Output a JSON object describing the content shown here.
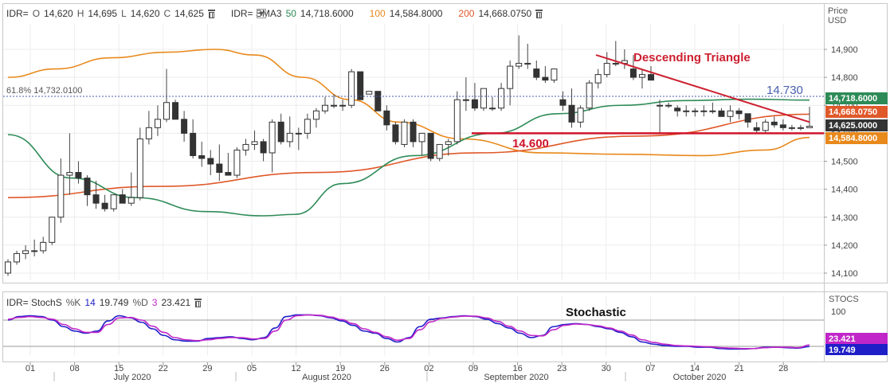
{
  "legend_main": {
    "symbol": "IDR=",
    "o_label": "O",
    "o_value": "14,620",
    "h_label": "H",
    "h_value": "14,695",
    "l_label": "L",
    "l_value": "14,620",
    "c_label": "C",
    "c_value": "14,625",
    "sma_label": "IDR= SMA3",
    "sma50_period": "50",
    "sma50_value": "14,718.6000",
    "sma100_period": "100",
    "sma100_value": "14,584.8000",
    "sma200_period": "200",
    "sma200_value": "14,668.0750"
  },
  "legend_stoch": {
    "label": "IDR= StochS",
    "k_label": "%K",
    "k_period": "14",
    "k_value": "19.749",
    "d_label": "%D",
    "d_period": "3",
    "d_value": "23.421"
  },
  "axis": {
    "price_title_1": "Price",
    "price_title_2": "USD",
    "stoch_title": "STOCS"
  },
  "colors": {
    "sma50": "#2e8b57",
    "sma100": "#e8891c",
    "sma200": "#e0592a",
    "triangle": "#cc2030",
    "support": "#d0142a",
    "stoch_k": "#1f1fc8",
    "stoch_d": "#c026c8",
    "fib": "#4a5fb0"
  },
  "chart_data": [
    {
      "type": "candlestick",
      "title": "",
      "ylabel": "Price USD",
      "ylim": [
        14070,
        14960
      ],
      "y_ticks": [
        "14,900",
        "14,800",
        "14,700",
        "14,600",
        "14,500",
        "14,400",
        "14,300",
        "14,200",
        "14,100"
      ],
      "x_ticks": [
        "01",
        "08",
        "15",
        "22",
        "29",
        "05",
        "12",
        "19",
        "26",
        "02",
        "09",
        "16",
        "23",
        "30",
        "07",
        "14",
        "21",
        "28"
      ],
      "months": [
        "July 2020",
        "August 2020",
        "September 2020",
        "October 2020"
      ],
      "candles_ohlc": [
        [
          14100,
          14150,
          14090,
          14140
        ],
        [
          14140,
          14180,
          14130,
          14170
        ],
        [
          14170,
          14200,
          14150,
          14180
        ],
        [
          14180,
          14220,
          14160,
          14180
        ],
        [
          14180,
          14230,
          14170,
          14210
        ],
        [
          14210,
          14300,
          14200,
          14300
        ],
        [
          14300,
          14510,
          14280,
          14450
        ],
        [
          14450,
          14600,
          14380,
          14460
        ],
        [
          14460,
          14500,
          14420,
          14440
        ],
        [
          14440,
          14450,
          14340,
          14380
        ],
        [
          14380,
          14430,
          14330,
          14350
        ],
        [
          14350,
          14380,
          14320,
          14330
        ],
        [
          14330,
          14380,
          14320,
          14380
        ],
        [
          14380,
          14400,
          14350,
          14350
        ],
        [
          14350,
          14460,
          14340,
          14370
        ],
        [
          14370,
          14620,
          14360,
          14580
        ],
        [
          14580,
          14680,
          14560,
          14620
        ],
        [
          14620,
          14700,
          14590,
          14650
        ],
        [
          14650,
          14830,
          14640,
          14710
        ],
        [
          14710,
          14720,
          14650,
          14650
        ],
        [
          14650,
          14680,
          14570,
          14600
        ],
        [
          14600,
          14650,
          14510,
          14520
        ],
        [
          14520,
          14570,
          14480,
          14510
        ],
        [
          14510,
          14540,
          14450,
          14490
        ],
        [
          14490,
          14560,
          14430,
          14460
        ],
        [
          14460,
          14530,
          14450,
          14450
        ],
        [
          14450,
          14550,
          14440,
          14540
        ],
        [
          14540,
          14580,
          14520,
          14560
        ],
        [
          14560,
          14610,
          14540,
          14570
        ],
        [
          14570,
          14580,
          14500,
          14530
        ],
        [
          14530,
          14650,
          14460,
          14640
        ],
        [
          14640,
          14670,
          14560,
          14570
        ],
        [
          14570,
          14660,
          14550,
          14600
        ],
        [
          14600,
          14620,
          14540,
          14600
        ],
        [
          14600,
          14670,
          14580,
          14650
        ],
        [
          14650,
          14690,
          14620,
          14680
        ],
        [
          14680,
          14730,
          14670,
          14700
        ],
        [
          14700,
          14740,
          14690,
          14700
        ],
        [
          14700,
          14720,
          14680,
          14700
        ],
        [
          14700,
          14830,
          14690,
          14820
        ],
        [
          14820,
          14820,
          14720,
          14720
        ],
        [
          14740,
          14750,
          14740,
          14750
        ],
        [
          14750,
          14750,
          14690,
          14680
        ],
        [
          14680,
          14700,
          14610,
          14630
        ],
        [
          14630,
          14640,
          14560,
          14570
        ],
        [
          14560,
          14650,
          14550,
          14640
        ],
        [
          14640,
          14650,
          14550,
          14570
        ],
        [
          14570,
          14600,
          14520,
          14600
        ],
        [
          14600,
          14600,
          14500,
          14510
        ],
        [
          14510,
          14560,
          14500,
          14560
        ],
        [
          14560,
          14580,
          14520,
          14570
        ],
        [
          14570,
          14750,
          14560,
          14720
        ],
        [
          14720,
          14800,
          14680,
          14720
        ],
        [
          14720,
          14780,
          14680,
          14690
        ],
        [
          14690,
          14760,
          14680,
          14760
        ],
        [
          14690,
          14730,
          14680,
          14690
        ],
        [
          14690,
          14780,
          14680,
          14760
        ],
        [
          14760,
          14860,
          14700,
          14840
        ],
        [
          14840,
          14950,
          14830,
          14850
        ],
        [
          14850,
          14920,
          14830,
          14850
        ],
        [
          14830,
          14860,
          14790,
          14800
        ],
        [
          14800,
          14840,
          14780,
          14790
        ],
        [
          14790,
          14830,
          14780,
          14830
        ],
        [
          14720,
          14750,
          14680,
          14700
        ],
        [
          14700,
          14760,
          14620,
          14640
        ],
        [
          14640,
          14700,
          14620,
          14690
        ],
        [
          14690,
          14790,
          14680,
          14780
        ],
        [
          14780,
          14830,
          14760,
          14810
        ],
        [
          14810,
          14890,
          14800,
          14850
        ],
        [
          14850,
          14930,
          14840,
          14850
        ],
        [
          14850,
          14900,
          14830,
          14860
        ],
        [
          14830,
          14880,
          14790,
          14800
        ],
        [
          14800,
          14830,
          14760,
          14810
        ],
        [
          14810,
          14840,
          14790,
          14790
        ],
        [
          14700,
          14720,
          14600,
          14700
        ],
        [
          14700,
          14710,
          14690,
          14700
        ],
        [
          14690,
          14700,
          14660,
          14680
        ],
        [
          14680,
          14700,
          14660,
          14680
        ],
        [
          14680,
          14690,
          14660,
          14680
        ],
        [
          14680,
          14700,
          14660,
          14680
        ],
        [
          14680,
          14710,
          14670,
          14680
        ],
        [
          14680,
          14690,
          14660,
          14660
        ],
        [
          14660,
          14700,
          14640,
          14680
        ],
        [
          14680,
          14690,
          14650,
          14670
        ],
        [
          14670,
          14670,
          14620,
          14640
        ],
        [
          14620,
          14640,
          14600,
          14610
        ],
        [
          14610,
          14650,
          14600,
          14640
        ],
        [
          14640,
          14660,
          14620,
          14630
        ],
        [
          14630,
          14650,
          14610,
          14620
        ],
        [
          14620,
          14630,
          14610,
          14620
        ],
        [
          14620,
          14630,
          14610,
          14620
        ],
        [
          14620,
          14695,
          14620,
          14625
        ]
      ],
      "series": [
        {
          "name": "SMA3 50",
          "last": 14718.6
        },
        {
          "name": "SMA3 100",
          "last": 14584.8
        },
        {
          "name": "SMA3 200",
          "last": 14668.075
        }
      ],
      "price_tags": [
        "14,718.6000",
        "14,668.0750",
        "14,625.0000",
        "14,584.8000"
      ],
      "fib_level": {
        "label": "61.8%",
        "value_text": "14,732.0100",
        "value": 14732.01
      },
      "annotations": [
        {
          "text": "Descending Triangle"
        },
        {
          "text": "14.730"
        },
        {
          "text": "14.600"
        }
      ],
      "support_level": 14600,
      "triangle_from": 14880,
      "triangle_to": 14640
    },
    {
      "type": "line",
      "title": "Stochastic",
      "ylim": [
        0,
        120
      ],
      "y_ticks": [
        "100"
      ],
      "series": [
        {
          "name": "%K",
          "values": [
            80,
            88,
            90,
            88,
            80,
            65,
            55,
            50,
            55,
            78,
            90,
            85,
            75,
            60,
            45,
            35,
            32,
            32,
            38,
            40,
            42,
            38,
            35,
            40,
            62,
            88,
            92,
            92,
            90,
            85,
            78,
            68,
            55,
            50,
            38,
            30,
            40,
            65,
            82,
            85,
            88,
            90,
            88,
            82,
            72,
            62,
            50,
            40,
            45,
            65,
            70,
            72,
            70,
            65,
            60,
            52,
            42,
            30,
            25,
            22,
            20,
            20,
            18,
            18,
            15,
            14,
            14,
            15,
            18,
            18,
            17,
            16,
            19.749
          ]
        },
        {
          "name": "%D",
          "values": [
            82,
            86,
            88,
            86,
            82,
            70,
            60,
            52,
            52,
            70,
            85,
            86,
            80,
            66,
            52,
            40,
            35,
            33,
            35,
            38,
            40,
            40,
            37,
            38,
            55,
            80,
            90,
            92,
            91,
            87,
            81,
            72,
            60,
            52,
            42,
            34,
            38,
            58,
            76,
            84,
            87,
            89,
            89,
            85,
            77,
            66,
            55,
            45,
            44,
            58,
            68,
            71,
            70,
            67,
            62,
            55,
            46,
            35,
            29,
            25,
            22,
            21,
            20,
            19,
            17,
            16,
            15,
            15,
            17,
            18,
            18,
            17,
            23.421
          ]
        }
      ]
    }
  ]
}
